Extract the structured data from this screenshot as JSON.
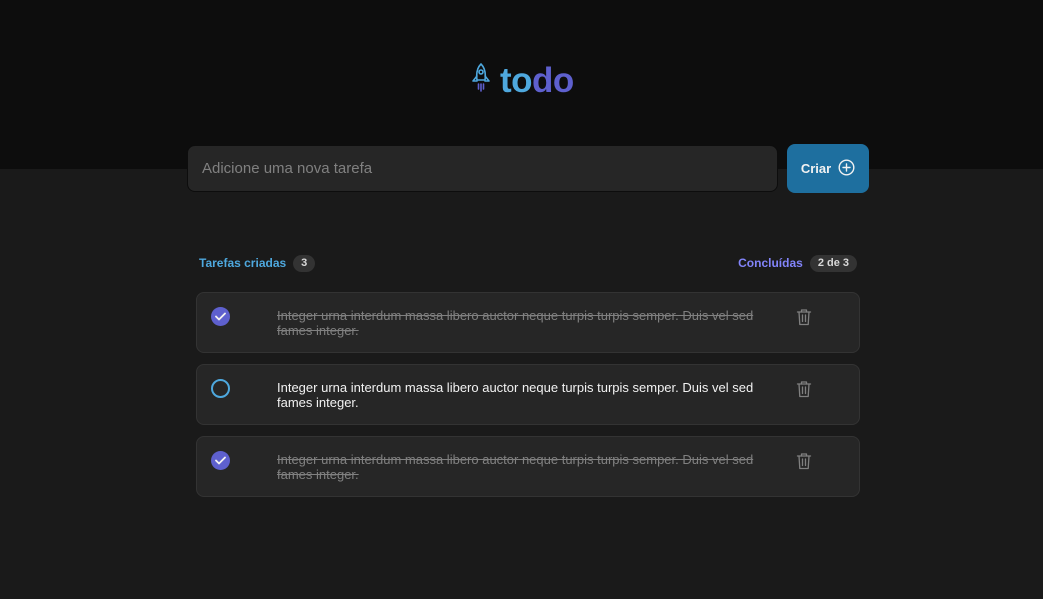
{
  "app": {
    "logo_to": "to",
    "logo_do": "do",
    "logo_icon": "rocket-icon"
  },
  "form": {
    "placeholder": "Adicione uma nova tarefa",
    "value": "",
    "create_label": "Criar",
    "create_icon": "plus-circle-icon"
  },
  "stats": {
    "created_label": "Tarefas criadas",
    "created_count": "3",
    "done_label": "Concluídas",
    "done_count": "2 de 3"
  },
  "tasks": [
    {
      "text": "Integer urna interdum massa libero auctor neque turpis turpis semper. Duis vel sed fames integer.",
      "done": true
    },
    {
      "text": "Integer urna interdum massa libero auctor neque turpis turpis semper. Duis vel sed fames integer.",
      "done": false
    },
    {
      "text": "Integer urna interdum massa libero auctor neque turpis turpis semper. Duis vel sed fames integer.",
      "done": true
    }
  ],
  "colors": {
    "blue": "#4ea8de",
    "purple": "#5e60ce",
    "purple_light": "#8284fa",
    "blue_dark": "#1e6f9f",
    "gray_100": "#f2f2f2",
    "gray_300": "#808080",
    "gray_400": "#333333",
    "gray_500": "#262626",
    "gray_600": "#1a1a1a",
    "gray_700": "#0d0d0d"
  }
}
